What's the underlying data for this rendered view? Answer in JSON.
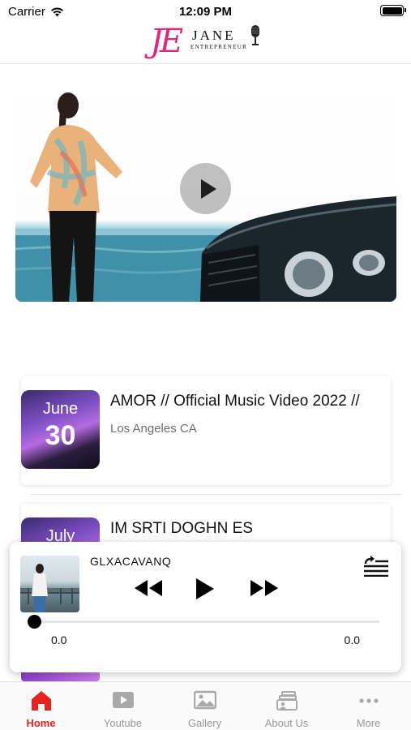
{
  "status_bar": {
    "carrier": "Carrier",
    "time": "12:09 PM"
  },
  "header": {
    "logo_monogram": "JE",
    "logo_name": "JANE",
    "logo_tagline": "ENTREPRENEUR"
  },
  "colors": {
    "accent": "#e8231f",
    "logo_pink": "#e0277a",
    "tab_inactive": "#9a9a9a"
  },
  "hero": {
    "play_icon": "play-icon"
  },
  "events": [
    {
      "month": "June",
      "day": "30",
      "title": "AMOR // Official Music Video 2022 //",
      "location": "Los Angeles CA"
    },
    {
      "month": "July",
      "day": "",
      "title": "IM SRTI DOGHN ES",
      "location": ""
    }
  ],
  "player": {
    "track_title": "GLXACAVANQ",
    "elapsed": "0.0",
    "duration": "0.0",
    "progress": 0
  },
  "tabs": [
    {
      "label": "Home",
      "icon": "home-icon",
      "active": true
    },
    {
      "label": "Youtube",
      "icon": "youtube-icon",
      "active": false
    },
    {
      "label": "Gallery",
      "icon": "gallery-icon",
      "active": false
    },
    {
      "label": "About Us",
      "icon": "about-us-icon",
      "active": false
    },
    {
      "label": "More",
      "icon": "more-icon",
      "active": false
    }
  ]
}
